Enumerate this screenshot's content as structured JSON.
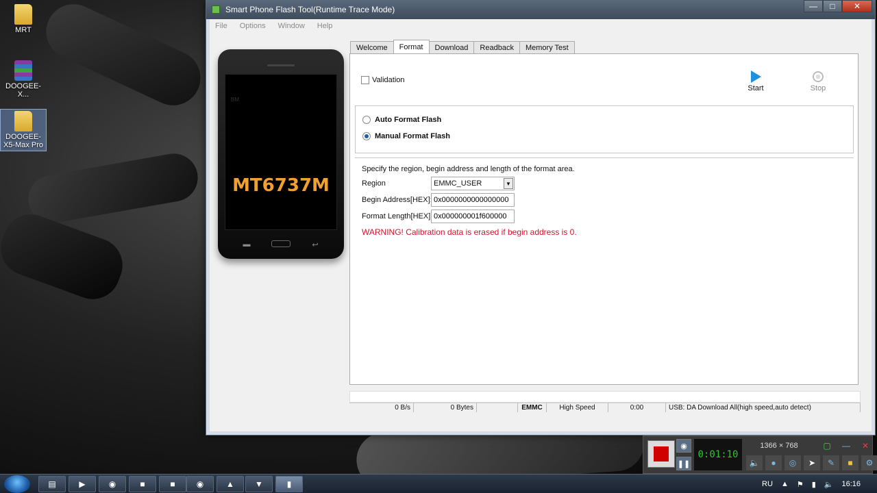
{
  "desktop": {
    "icons": [
      {
        "label": "MRT",
        "kind": "folder-icon"
      },
      {
        "label": "DOOGEE-X...",
        "kind": "archive-icon"
      },
      {
        "label": "DOOGEE-X5-Max Pro",
        "kind": "folder-icon"
      }
    ]
  },
  "window": {
    "title": "Smart Phone Flash Tool(Runtime Trace Mode)",
    "menu": [
      "File",
      "Options",
      "Window",
      "Help"
    ],
    "phone": {
      "chip": "MT6737M",
      "brand_mark": "BM"
    },
    "tabs": [
      "Welcome",
      "Format",
      "Download",
      "Readback",
      "Memory Test"
    ],
    "active_tab": "Format",
    "format": {
      "validation_label": "Validation",
      "start_label": "Start",
      "stop_label": "Stop",
      "auto_label": "Auto Format Flash",
      "manual_label": "Manual Format Flash",
      "selected_mode": "Manual Format Flash",
      "description": "Specify the region, begin address and length of the format area.",
      "region_label": "Region",
      "region_value": "EMMC_USER",
      "begin_label": "Begin Address[HEX]:",
      "begin_value": "0x0000000000000000",
      "length_label": "Format Length[HEX]:",
      "length_value": "0x000000001f600000",
      "warning": "WARNING! Calibration data is erased if begin address is 0."
    },
    "status": {
      "speed": "0 B/s",
      "bytes": "0 Bytes",
      "storage": "EMMC",
      "mode": "High Speed",
      "time": "0:00",
      "usb": "USB: DA Download All(high speed,auto detect)"
    }
  },
  "recorder": {
    "time": "0:01:10",
    "resolution": "1366 × 768"
  },
  "taskbar": {
    "lang": "RU",
    "clock": "16:16"
  },
  "colors": {
    "warning": "#d4122c",
    "chip_text": "#f0a030",
    "play": "#1e90e0",
    "record": "#d00000"
  }
}
